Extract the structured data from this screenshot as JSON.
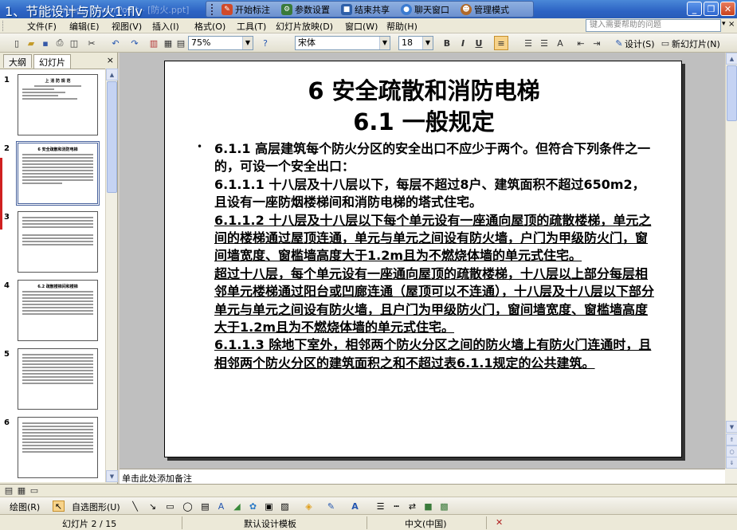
{
  "window": {
    "overlay_title": "1、节能设计与防火1.flv",
    "ghost_title": "Microsoft PowerPoint - [防火.ppt]"
  },
  "meeting_toolbar": {
    "items": [
      "开始标注",
      "参数设置",
      "结束共享",
      "聊天窗口",
      "管理模式"
    ]
  },
  "menu": {
    "items": [
      "文件(F)",
      "编辑(E)",
      "视图(V)",
      "插入(I)",
      "格式(O)",
      "工具(T)",
      "幻灯片放映(D)",
      "窗口(W)",
      "帮助(H)"
    ],
    "help_placeholder": "键入需要帮助的问题"
  },
  "toolbar": {
    "zoom": "75%",
    "font_name": "宋体",
    "font_size": "18",
    "bold": "B",
    "italic": "I",
    "underline": "U",
    "design_label": "设计(S)",
    "new_slide_label": "新幻灯片(N)"
  },
  "left_panel": {
    "tabs": [
      "大纲",
      "幻灯片"
    ],
    "close": "×",
    "thumbnails": [
      {
        "num": "1",
        "title": "上 消 防 规 范"
      },
      {
        "num": "2",
        "title": "6 安全疏散和消防电梯"
      },
      {
        "num": "3",
        "title": ""
      },
      {
        "num": "4",
        "title": "6.2 疏散楼梯间和楼梯"
      },
      {
        "num": "5",
        "title": ""
      },
      {
        "num": "6",
        "title": ""
      }
    ]
  },
  "slide": {
    "title_line1": "6 安全疏散和消防电梯",
    "title_line2": "6.1 一般规定",
    "bullet": "•",
    "paragraphs": [
      {
        "text": "6.1.1 高层建筑每个防火分区的安全出口不应少于两个。但符合下列条件之一的，可设一个安全出口：",
        "underline": false
      },
      {
        "text": "6.1.1.1 十八层及十八层以下，每层不超过8户、建筑面积不超过650m2，且设有一座防烟楼梯间和消防电梯的塔式住宅。",
        "underline": false
      },
      {
        "text": "6.1.1.2 十八层及十八层以下每个单元设有一座通向屋顶的疏散楼梯，单元之间的楼梯通过屋顶连通，单元与单元之间设有防火墙，户门为甲级防火门，窗间墙宽度、窗槛墙高度大于1.2m且为不燃烧体墙的单元式住宅。",
        "underline": true
      },
      {
        "text": "超过十八层，每个单元设有一座通向屋顶的疏散楼梯，十八层以上部分每层相邻单元楼梯通过阳台或凹廊连通（屋顶可以不连通），十八层及十八层以下部分单元与单元之间设有防火墙，且户门为甲级防火门，窗间墙宽度、窗槛墙高度大于1.2m且为不燃烧体墙的单元式住宅。",
        "underline": true
      },
      {
        "text": "6.1.1.3 除地下室外，相邻两个防火分区之间的防火墙上有防火门连通时，且相邻两个防火分区的建筑面积之和不超过表6.1.1规定的公共建筑。",
        "underline": true
      }
    ]
  },
  "notes": {
    "placeholder": "单击此处添加备注"
  },
  "drawing_toolbar": {
    "draw_label": "绘图(R)",
    "autoshapes_label": "自选图形(U)"
  },
  "status": {
    "slide_info": "幻灯片 2 / 15",
    "template": "默认设计模板",
    "language": "中文(中国)"
  }
}
